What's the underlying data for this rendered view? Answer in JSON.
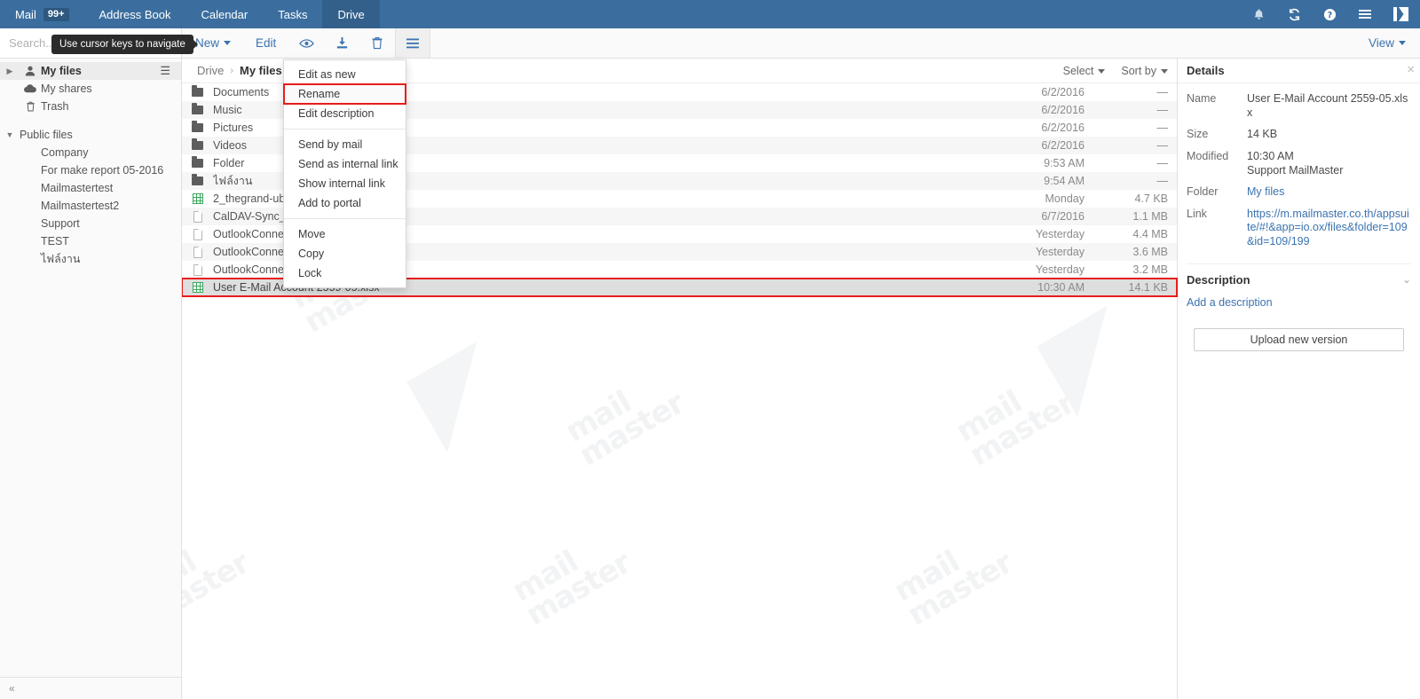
{
  "topbar": {
    "tabs": [
      {
        "label": "Mail",
        "badge": "99+",
        "active": false
      },
      {
        "label": "Address Book",
        "badge": "",
        "active": false
      },
      {
        "label": "Calendar",
        "badge": "",
        "active": false
      },
      {
        "label": "Tasks",
        "badge": "",
        "active": false
      },
      {
        "label": "Drive",
        "badge": "",
        "active": true
      }
    ],
    "icons": [
      "bell-icon",
      "refresh-icon",
      "help-icon",
      "menu-icon"
    ],
    "logo": "mailmaster-logo",
    "bg_color": "#3b6e9f",
    "active_tab_color": "#33608b"
  },
  "toolbar": {
    "search_placeholder": "Search...",
    "search_value": "",
    "tooltip": "Use cursor keys to navigate",
    "new_label": "New",
    "edit_label": "Edit",
    "view_label": "View",
    "icons": [
      "eye-icon",
      "download-icon",
      "trash-icon",
      "hamburger-icon"
    ]
  },
  "sidebar": {
    "my_files": {
      "label": "My files",
      "icon": "user-icon"
    },
    "items": [
      {
        "label": "My shares",
        "icon": "cloud-icon"
      },
      {
        "label": "Trash",
        "icon": "trash-icon"
      }
    ],
    "public_group": "Public files",
    "public_items": [
      "Company",
      "For make report 05-2016",
      "Mailmastertest",
      "Mailmastertest2",
      "Support",
      "TEST",
      "ไฟล์งาน"
    ],
    "collapse_label": "«"
  },
  "breadcrumb": {
    "root": "Drive",
    "separator": "›",
    "current": "My files",
    "select_label": "Select",
    "sort_label": "Sort by"
  },
  "files": [
    {
      "name": "Documents",
      "icon": "folder",
      "date": "6/2/2016",
      "size": "—"
    },
    {
      "name": "Music",
      "icon": "folder",
      "date": "6/2/2016",
      "size": "—"
    },
    {
      "name": "Pictures",
      "icon": "folder",
      "date": "6/2/2016",
      "size": "—"
    },
    {
      "name": "Videos",
      "icon": "folder",
      "date": "6/2/2016",
      "size": "—"
    },
    {
      "name": "Folder",
      "icon": "folder",
      "date": "9:53 AM",
      "size": "—"
    },
    {
      "name": "ไฟล์งาน",
      "icon": "folder",
      "date": "9:54 AM",
      "size": "—"
    },
    {
      "name": "2_thegrand-ub.c",
      "icon": "sheet",
      "date": "Monday",
      "size": "4.7 KB"
    },
    {
      "name": "CalDAV-Sync_v",
      "icon": "doc",
      "date": "6/7/2016",
      "size": "1.1 MB"
    },
    {
      "name": "OutlookConnec",
      "icon": "doc",
      "date": "Yesterday",
      "size": "4.4 MB"
    },
    {
      "name": "OutlookConnec",
      "icon": "doc",
      "date": "Yesterday",
      "size": "3.6 MB"
    },
    {
      "name": "OutlookConnec",
      "icon": "doc",
      "date": "Yesterday",
      "size": "3.2 MB"
    },
    {
      "name": "User E-Mail Account 2559-05.xlsx",
      "icon": "sheet",
      "date": "10:30 AM",
      "size": "14.1 KB"
    }
  ],
  "context_menu": {
    "groups": [
      [
        "Edit as new",
        "Rename",
        "Edit description"
      ],
      [
        "Send by mail",
        "Send as internal link",
        "Show internal link",
        "Add to portal"
      ],
      [
        "Move",
        "Copy",
        "Lock"
      ]
    ],
    "highlighted": "Rename",
    "highlight_color": "#e81c1c"
  },
  "details": {
    "title": "Details",
    "close_icon": "close-icon",
    "rows": [
      {
        "key": "Name",
        "value": "User E-Mail Account 2559-05.xlsx",
        "link": false
      },
      {
        "key": "Size",
        "value": "14 KB",
        "link": false
      },
      {
        "key": "Modified",
        "value": "10:30 AM\nSupport MailMaster",
        "link": false
      },
      {
        "key": "Folder",
        "value": "My files",
        "link": true
      },
      {
        "key": "Link",
        "value": "https://m.mailmaster.co.th/appsuite/#!&app=io.ox/files&folder=109&id=109/199",
        "link": true
      }
    ],
    "description_title": "Description",
    "description_add": "Add a description",
    "upload_label": "Upload new version"
  },
  "watermark_text": "mail\nmaster"
}
